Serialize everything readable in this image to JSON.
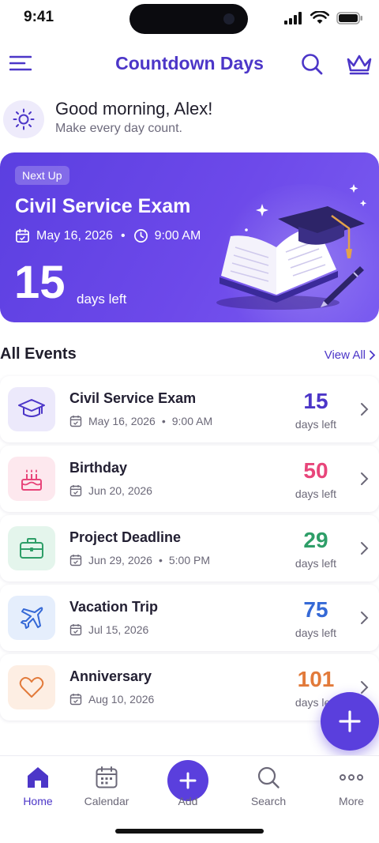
{
  "status_bar": {
    "time": "9:41"
  },
  "header": {
    "title": "Countdown Days"
  },
  "greeting": {
    "title": "Good morning, Alex!",
    "subtitle": "Make every day count."
  },
  "hero": {
    "badge": "Next Up",
    "title": "Civil Service Exam",
    "date": "May 16, 2026",
    "time": "9:00 AM",
    "count": "15",
    "count_label": "days left"
  },
  "events_section": {
    "title": "All Events",
    "view_all": "View All"
  },
  "events": [
    {
      "title": "Civil Service Exam",
      "date": "May 16, 2026",
      "time": "9:00 AM",
      "count": "15",
      "count_label": "days left",
      "icon": "graduation-cap-icon",
      "color": "#4c36c8",
      "bg": "#ece9fb"
    },
    {
      "title": "Birthday",
      "date": "Jun 20, 2026",
      "time": "",
      "count": "50",
      "count_label": "days left",
      "icon": "cake-icon",
      "color": "#e8457a",
      "bg": "#fde8ee"
    },
    {
      "title": "Project Deadline",
      "date": "Jun 29, 2026",
      "time": "5:00 PM",
      "count": "29",
      "count_label": "days left",
      "icon": "briefcase-icon",
      "color": "#2e9e68",
      "bg": "#e4f5ec"
    },
    {
      "title": "Vacation Trip",
      "date": "Jul 15, 2026",
      "time": "",
      "count": "75",
      "count_label": "days left",
      "icon": "airplane-icon",
      "color": "#3569d6",
      "bg": "#e5eefc"
    },
    {
      "title": "Anniversary",
      "date": "Aug 10, 2026",
      "time": "",
      "count": "101",
      "count_label": "days left",
      "icon": "heart-icon",
      "color": "#e27a3a",
      "bg": "#fdeee3"
    }
  ],
  "tabs": [
    {
      "label": "Home",
      "icon": "home-icon"
    },
    {
      "label": "Calendar",
      "icon": "calendar-icon"
    },
    {
      "label": "Add",
      "icon": "plus-icon"
    },
    {
      "label": "Search",
      "icon": "search-icon"
    },
    {
      "label": "More",
      "icon": "more-icon"
    }
  ],
  "colors": {
    "accent": "#4c36c8",
    "fab": "#5a3fdd"
  }
}
